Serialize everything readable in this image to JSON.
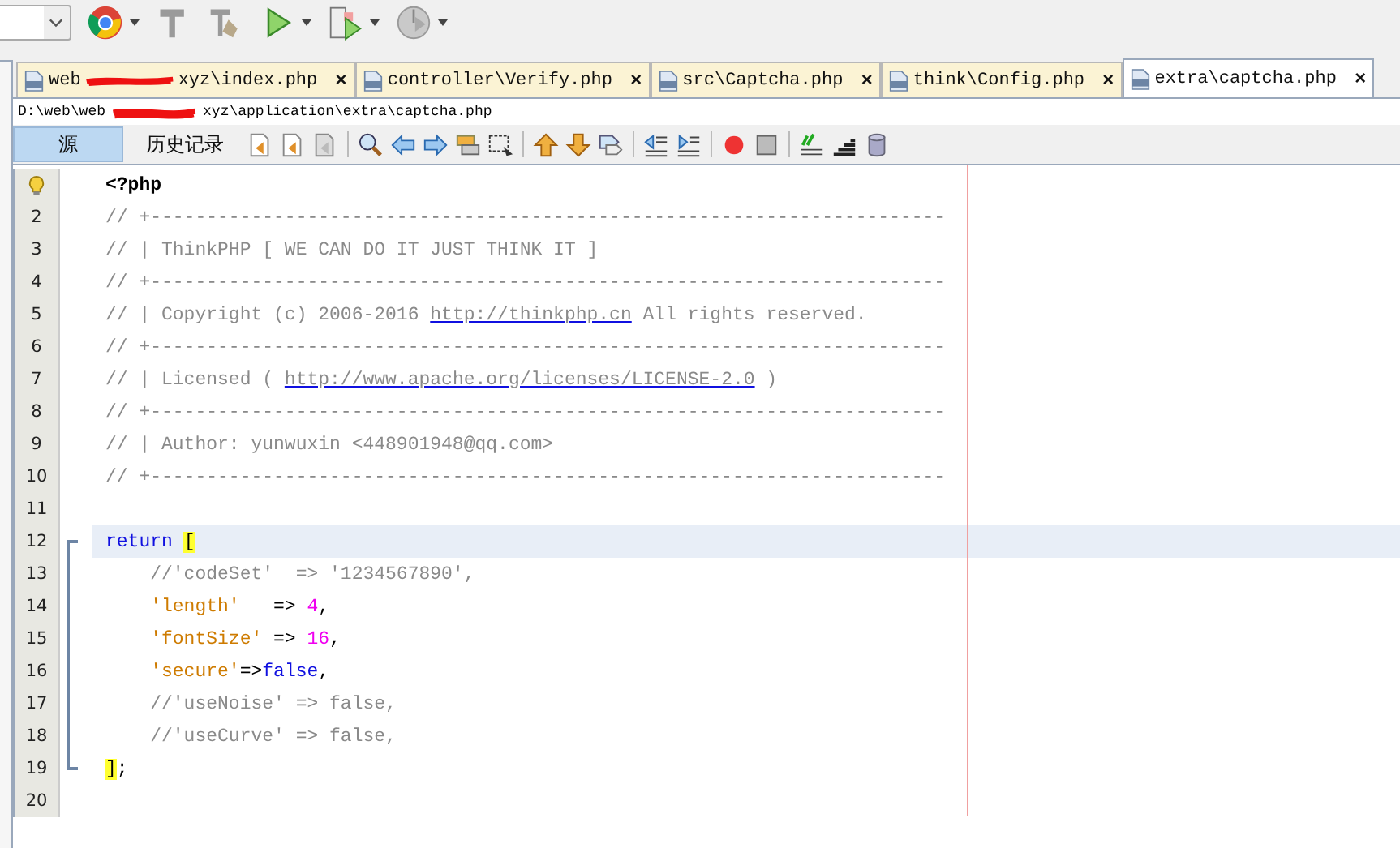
{
  "editor_tabs": [
    {
      "label_start": "web",
      "label_end": "xyz\\index.php",
      "redacted": true,
      "selected": false,
      "close": "×"
    },
    {
      "label": "controller\\Verify.php",
      "selected": false,
      "close": "×"
    },
    {
      "label": "src\\Captcha.php",
      "selected": false,
      "close": "×"
    },
    {
      "label": "think\\Config.php",
      "selected": false,
      "close": "×"
    },
    {
      "label": "extra\\captcha.php",
      "selected": true,
      "close": "×"
    }
  ],
  "file_path": {
    "start": "D:\\web\\web",
    "end": "xyz\\application\\extra\\captcha.php",
    "redacted": true
  },
  "view_tabs": [
    {
      "label": "源",
      "selected": true
    },
    {
      "label": "历史记录",
      "selected": false
    }
  ],
  "lines": [
    {
      "hint": true,
      "tokens": [
        {
          "kind": "tag",
          "text": "<?php"
        }
      ]
    },
    {
      "number": "2",
      "tokens": [
        {
          "kind": "comment",
          "text": "// +-----------------------------------------------------------------------"
        }
      ]
    },
    {
      "number": "3",
      "tokens": [
        {
          "kind": "comment",
          "text": "// | ThinkPHP [ WE CAN DO IT JUST THINK IT ]"
        }
      ]
    },
    {
      "number": "4",
      "tokens": [
        {
          "kind": "comment",
          "text": "// +-----------------------------------------------------------------------"
        }
      ]
    },
    {
      "number": "5",
      "tokens": [
        {
          "kind": "comment",
          "text": "// | Copyright (c) 2006-2016 "
        },
        {
          "kind": "link",
          "text": "http://thinkphp.cn"
        },
        {
          "kind": "comment",
          "text": " All rights reserved."
        }
      ]
    },
    {
      "number": "6",
      "tokens": [
        {
          "kind": "comment",
          "text": "// +-----------------------------------------------------------------------"
        }
      ]
    },
    {
      "number": "7",
      "tokens": [
        {
          "kind": "comment",
          "text": "// | Licensed ( "
        },
        {
          "kind": "link",
          "text": "http://www.apache.org/licenses/LICENSE-2.0"
        },
        {
          "kind": "comment",
          "text": " )"
        }
      ]
    },
    {
      "number": "8",
      "tokens": [
        {
          "kind": "comment",
          "text": "// +-----------------------------------------------------------------------"
        }
      ]
    },
    {
      "number": "9",
      "tokens": [
        {
          "kind": "comment",
          "text": "// | Author: yunwuxin <448901948@qq.com>"
        }
      ]
    },
    {
      "number": "10",
      "tokens": [
        {
          "kind": "comment",
          "text": "// +-----------------------------------------------------------------------"
        }
      ]
    },
    {
      "number": "11"
    },
    {
      "number": "12",
      "current": true,
      "in_fold": true,
      "tokens": [
        {
          "kind": "keyword",
          "text": "return "
        },
        {
          "kind": "bracket",
          "text": "["
        }
      ]
    },
    {
      "number": "13",
      "in_fold": true,
      "tokens": [
        {
          "kind": "comment",
          "text": "    //'codeSet'  => '1234567890',"
        }
      ]
    },
    {
      "number": "14",
      "in_fold": true,
      "tokens": [
        {
          "kind": "string",
          "text": "    'length'"
        },
        {
          "kind": "op",
          "text": "   => "
        },
        {
          "kind": "number",
          "text": "4"
        },
        {
          "kind": "op",
          "text": ","
        }
      ]
    },
    {
      "number": "15",
      "in_fold": true,
      "tokens": [
        {
          "kind": "string",
          "text": "    'fontSize'"
        },
        {
          "kind": "op",
          "text": " => "
        },
        {
          "kind": "number",
          "text": "16"
        },
        {
          "kind": "op",
          "text": ","
        }
      ]
    },
    {
      "number": "16",
      "in_fold": true,
      "tokens": [
        {
          "kind": "string",
          "text": "    'secure'"
        },
        {
          "kind": "op",
          "text": "=>"
        },
        {
          "kind": "keyword",
          "text": "false"
        },
        {
          "kind": "op",
          "text": ","
        }
      ]
    },
    {
      "number": "17",
      "in_fold": true,
      "tokens": [
        {
          "kind": "comment",
          "text": "    //'useNoise' => false,"
        }
      ]
    },
    {
      "number": "18",
      "in_fold": true,
      "tokens": [
        {
          "kind": "comment",
          "text": "    //'useCurve' => false,"
        }
      ]
    },
    {
      "number": "19",
      "in_fold": true,
      "tokens": [
        {
          "kind": "bracket",
          "text": "]"
        },
        {
          "kind": "op",
          "text": ";"
        }
      ]
    },
    {
      "number": "20"
    }
  ]
}
